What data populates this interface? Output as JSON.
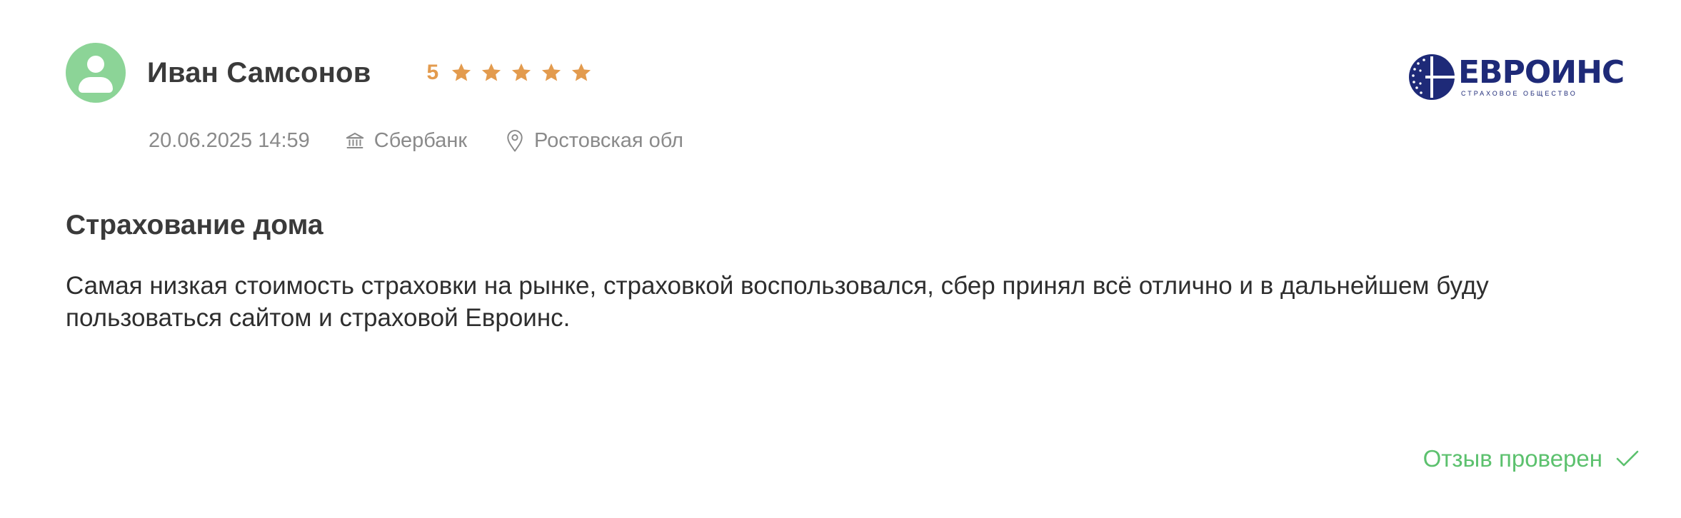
{
  "review": {
    "author": "Иван Самсонов",
    "rating": {
      "value": "5",
      "stars_filled": 5,
      "stars_total": 5,
      "star_color": "#e39b4e"
    },
    "meta": {
      "date": "20.06.2025 14:59",
      "bank": "Сбербанк",
      "region": "Ростовская обл"
    },
    "title": "Страхование дома",
    "text": "Самая низкая стоимость страховки на рынке, страховкой воспользовался, сбер принял всё отлично и в дальнейшем буду пользоваться сайтом и страховой Евроинс.",
    "verified_label": "Отзыв проверен",
    "company_logo": {
      "name": "ЕВРОИНС",
      "tagline": "СТРАХОВОЕ ОБЩЕСТВО",
      "color": "#1e2a78"
    },
    "icons": {
      "avatar": "user-avatar-icon",
      "star": "star-icon",
      "bank": "bank-building-icon",
      "region": "map-pin-icon",
      "verified": "checkmark-icon"
    },
    "colors": {
      "avatar_bg": "#8cd497",
      "verified": "#5cc16e",
      "meta_text": "#8a8a8a"
    }
  }
}
